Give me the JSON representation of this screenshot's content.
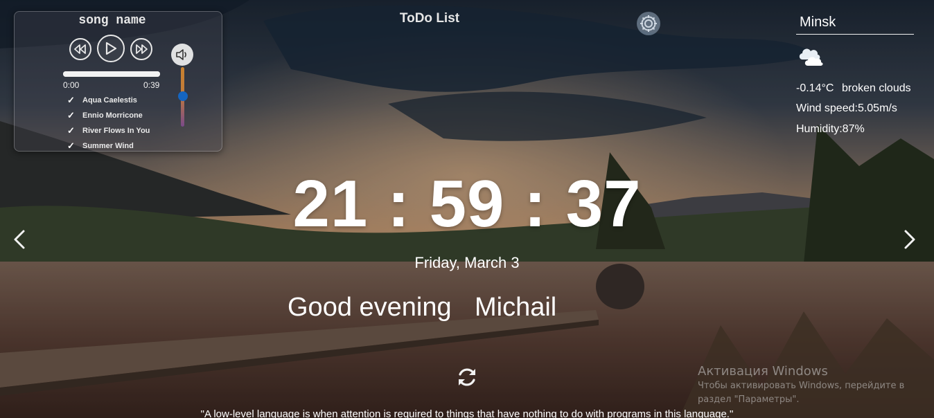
{
  "player": {
    "song_name": "song name",
    "time_current": "0:00",
    "time_duration": "0:39",
    "progress": 1.0,
    "volume_level": 0.5,
    "controls": [
      "rewind-icon",
      "play-icon",
      "fast-forward-icon",
      "volume-icon"
    ],
    "playlist": [
      {
        "check": "✓",
        "title": "Aqua Caelestis"
      },
      {
        "check": "✓",
        "title": "Ennio Morricone"
      },
      {
        "check": "✓",
        "title": "River Flows In You"
      },
      {
        "check": "✓",
        "title": "Summer Wind"
      }
    ]
  },
  "header": {
    "todo_label": "ToDo List",
    "settings_icon": "gear-icon"
  },
  "weather": {
    "city": "Minsk",
    "icon": "broken-clouds-icon",
    "temperature": "-0.14°C",
    "description": "broken clouds",
    "wind": "Wind speed:5.05m/s",
    "humidity": "Humidity:87%"
  },
  "clock": {
    "time": "21:59:37",
    "date": "Friday, March 3"
  },
  "greeting": {
    "text": "Good evening ",
    "name": "Michail"
  },
  "slider": {
    "prev_icon": "chevron-left-icon",
    "next_icon": "chevron-right-icon"
  },
  "quote": {
    "refresh_icon": "refresh-icon",
    "text": "\"A low-level language is when attention is required to things that have nothing to do with programs in this language.\""
  },
  "windows_watermark": {
    "title": "Активация Windows",
    "line1": "Чтобы активировать Windows, перейдите в",
    "line2": "раздел \"Параметры\"."
  },
  "colors": {
    "text": "#ffffff",
    "volume_knob": "#1565c0",
    "volume_track": "#c9822f"
  }
}
